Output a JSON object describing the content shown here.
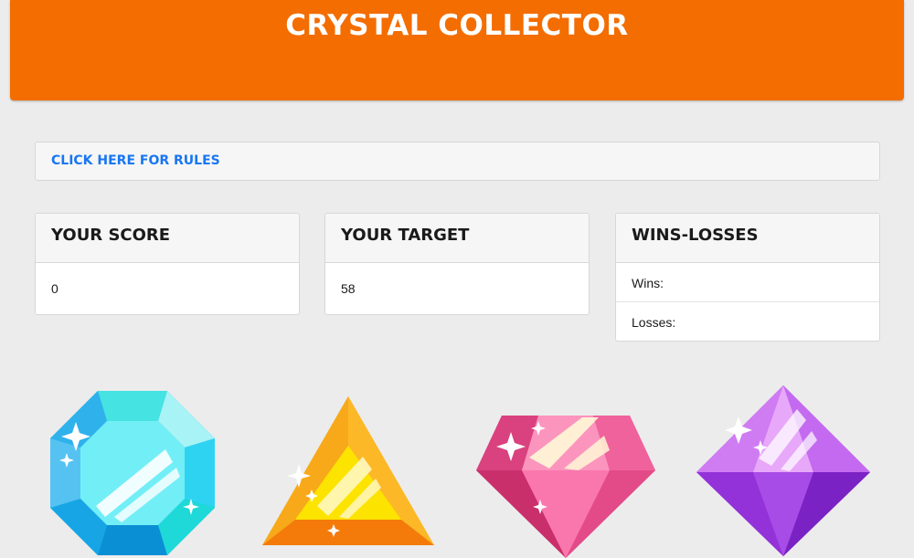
{
  "header": {
    "title": "CRYSTAL COLLECTOR"
  },
  "rules": {
    "link_label": "CLICK HERE FOR RULES"
  },
  "score": {
    "title": "YOUR SCORE",
    "value": "0"
  },
  "target": {
    "title": "YOUR TARGET",
    "value": "58"
  },
  "record": {
    "title": "WINS-LOSSES",
    "wins_label": "Wins:",
    "losses_label": "Losses:"
  },
  "crystals": [
    {
      "name": "blue-octagon-crystal",
      "icon": "blue-crystal-icon",
      "color": "#3ec9f0"
    },
    {
      "name": "yellow-triangle-crystal",
      "icon": "yellow-crystal-icon",
      "color": "#f5a623"
    },
    {
      "name": "pink-diamond-crystal",
      "icon": "pink-crystal-icon",
      "color": "#f0629c"
    },
    {
      "name": "purple-octahedron-crystal",
      "icon": "purple-crystal-icon",
      "color": "#a341e6"
    }
  ],
  "colors": {
    "header": "#f36d00",
    "link": "#1876f2",
    "background": "#ececec"
  }
}
